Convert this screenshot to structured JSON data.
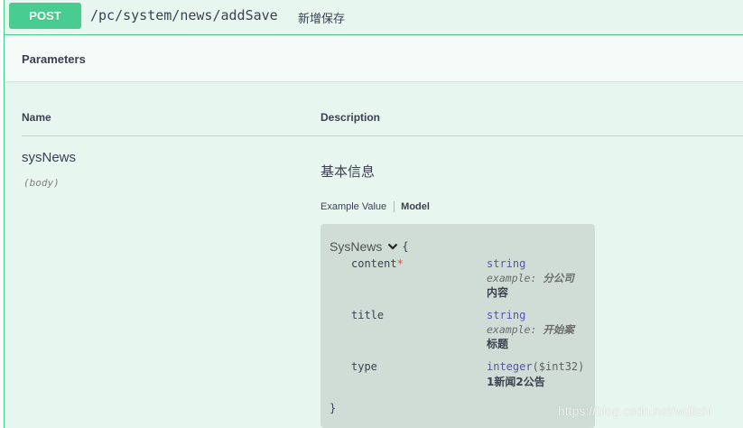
{
  "operation": {
    "method": "POST",
    "path": "/pc/system/news/addSave",
    "summary": "新增保存"
  },
  "parameters": {
    "title": "Parameters",
    "columns": {
      "name": "Name",
      "description": "Description"
    },
    "param": {
      "name": "sysNews",
      "in": "(body)",
      "description": "基本信息"
    },
    "tabs": {
      "example": "Example Value",
      "model": "Model"
    }
  },
  "model": {
    "name": "SysNews",
    "open_brace": "{",
    "close_brace": "}",
    "properties": [
      {
        "name": "content",
        "required": "*",
        "type": "string",
        "example_label": "example:",
        "example_value": "分公司",
        "description": "内容"
      },
      {
        "name": "title",
        "required": "",
        "type": "string",
        "example_label": "example:",
        "example_value": "开始案",
        "description": "标题"
      },
      {
        "name": "type",
        "required": "",
        "type": "integer",
        "format": "($int32)",
        "description": "1新闻2公告"
      }
    ]
  },
  "watermark": "https://blog.csdn.net/wdlizhi",
  "colors": {
    "post": "#49cc90",
    "background": "#e8f6f0",
    "required": "#f93e3e",
    "type": "#5555aa"
  }
}
